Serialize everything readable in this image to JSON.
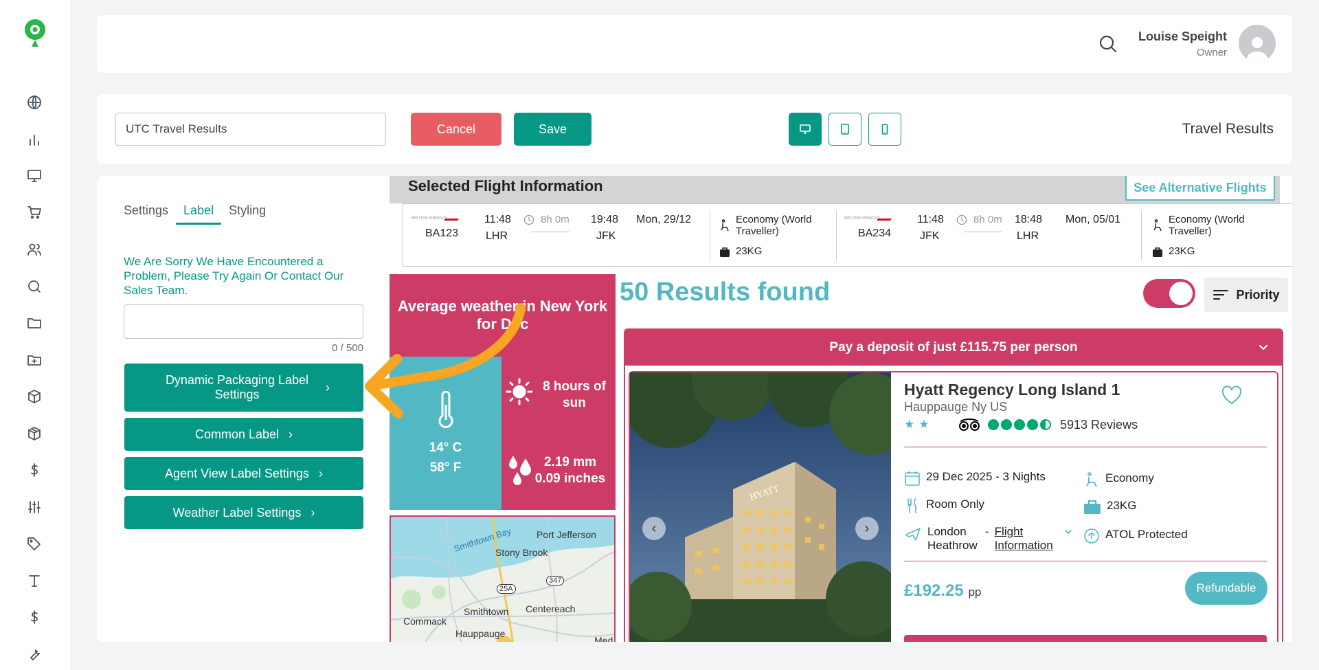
{
  "topbar": {
    "user_name": "Louise Speight",
    "user_role": "Owner"
  },
  "toolbar": {
    "name_value": "UTC Travel Results",
    "cancel_label": "Cancel",
    "save_label": "Save",
    "page_heading": "Travel Results",
    "devices": [
      "desktop-icon",
      "tablet-icon",
      "mobile-icon"
    ],
    "active_device": "desktop"
  },
  "panel": {
    "tabs": [
      "Settings",
      "Label",
      "Styling"
    ],
    "active_tab": "Label",
    "error_message": "We Are Sorry We Have Encountered a Problem, Please Try Again Or Contact Our Sales Team.",
    "counter": "0 / 500",
    "buttons": [
      "Dynamic Packaging Label Settings",
      "Common Label",
      "Agent View Label Settings",
      "Weather Label Settings"
    ]
  },
  "flight": {
    "title": "Selected Flight Information",
    "alt_label": "See Alternative Flights",
    "airline_logo_text": "BRITISH AIRWAYS",
    "legs": [
      {
        "code": "BA123",
        "dep_time": "11:48",
        "dep_ap": "LHR",
        "duration": "8h 0m",
        "arr_time": "19:48",
        "arr_ap": "JFK",
        "date": "Mon, 29/12",
        "cabin": "Economy (World Traveller)",
        "bag": "23KG"
      },
      {
        "code": "BA234",
        "dep_time": "11:48",
        "dep_ap": "JFK",
        "duration": "8h 0m",
        "arr_time": "18:48",
        "arr_ap": "LHR",
        "date": "Mon, 05/01",
        "cabin": "Economy (World Traveller)",
        "bag": "23KG"
      }
    ]
  },
  "weather": {
    "title": "Average weather in New York for Dec",
    "temp_c": "14° C",
    "temp_f": "58° F",
    "sun": "8 hours of sun",
    "rain_mm": "2.19 mm",
    "rain_in": "0.09 inches"
  },
  "map": {
    "places": [
      "Smithtown Bay",
      "Port Jefferson",
      "Stony Brook",
      "25A",
      "347",
      "Smithtown",
      "Centereach",
      "Commack",
      "Hauppauge",
      "Med"
    ]
  },
  "results": {
    "count_text": "50 Results found",
    "priority_label": "Priority",
    "toggle_on": true
  },
  "hotel": {
    "deposit_text": "Pay a deposit of just £115.75 per person",
    "name": "Hyatt Regency Long Island 1",
    "location": "Hauppauge Ny US",
    "star_rating": 2,
    "ta_bubbles": 4.5,
    "reviews": "5913 Reviews",
    "dates": "29 Dec 2025 - 3 Nights",
    "board": "Room Only",
    "departure": "London Heathrow",
    "flight_info_label": "Flight Information",
    "cabin": "Economy",
    "baggage": "23KG",
    "atol": "ATOL Protected",
    "price": "£192.25",
    "price_unit": "pp",
    "refundable": "Refundable",
    "photo_sign": "HYATT"
  },
  "colors": {
    "teal": "#069785",
    "pink": "#cc3c67",
    "cyan": "#52b8c4",
    "red": "#e85d62",
    "arrow": "#f6a623"
  }
}
